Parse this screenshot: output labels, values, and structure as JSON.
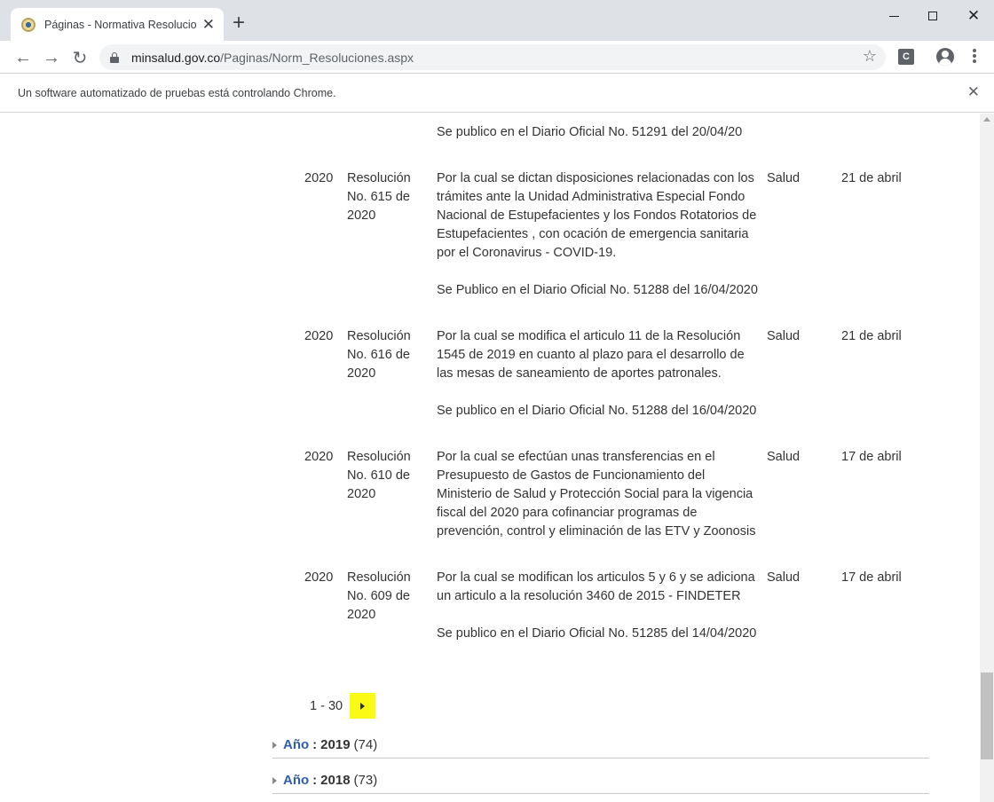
{
  "browser": {
    "tab_title": "Páginas - Normativa Resoluciones",
    "tab_close": "✕",
    "new_tab": "+",
    "win_close": "✕",
    "url_host": "minsalud.gov.co",
    "url_path": "/Paginas/Norm_Resoluciones.aspx",
    "bookmark_icon": "☆",
    "extension_label": "C",
    "back_icon": "←",
    "forward_icon": "→",
    "reload_icon": "↻",
    "infobar_text": "Un software automatizado de pruebas está controlando Chrome.",
    "infobar_close": "✕"
  },
  "rows": [
    {
      "year": "",
      "name": "",
      "desc": [
        "Se publico en el Diario Oficial No. 51291 del 20/04/20"
      ],
      "sector": "",
      "date": ""
    },
    {
      "year": "2020",
      "name": "Resolución No. 615 de 2020",
      "desc": [
        "Por la cual se dictan disposiciones relacionadas con los trámites ante la Unidad Administrativa Especial Fondo Nacional de Estupefacientes y los Fondos Rotatorios de Estupefacientes , con ocación de emergencia sanitaria por el Coronavirus - COVID-19.",
        "Se Publico en el Diario Oficial No. 51288 del 16/04/2020"
      ],
      "sector": "Salud",
      "date": "21 de abril"
    },
    {
      "year": "2020",
      "name": "Resolución No. 616 de 2020",
      "desc": [
        "Por la cual se modifica el articulo 11 de la Resolución 1545 de 2019 en cuanto al plazo para el desarrollo de las mesas de saneamiento de aportes patronales.",
        "Se publico en el Diario Oficial No. 51288 del 16/04/2020"
      ],
      "sector": "Salud",
      "date": "21 de abril"
    },
    {
      "year": "2020",
      "name": "Resolución No. 610 de 2020",
      "desc": [
        "Por la cual se efectúan unas transferencias en el Presupuesto de Gastos de Funcionamiento del Ministerio de Salud y Protección Social para la vigencia fiscal del 2020 para cofinanciar programas de prevención, control y eliminación de las ETV y Zoonosis"
      ],
      "sector": "Salud",
      "date": "17 de abril"
    },
    {
      "year": "2020",
      "name": "Resolución No. 609 de 2020",
      "desc": [
        "Por la cual se modifican los articulos 5 y 6 y se adiciona un articulo a la resolución 3460 de 2015 - FINDETER",
        "Se publico en el Diario Oficial No. 51285 del 14/04/2020"
      ],
      "sector": "Salud",
      "date": "17 de abril"
    }
  ],
  "pager": {
    "range": "1 - 30"
  },
  "year_groups": [
    {
      "label": "Año",
      "sep": ":",
      "year": "2019",
      "count": "(74)"
    },
    {
      "label": "Año",
      "sep": ":",
      "year": "2018",
      "count": "(73)"
    }
  ]
}
